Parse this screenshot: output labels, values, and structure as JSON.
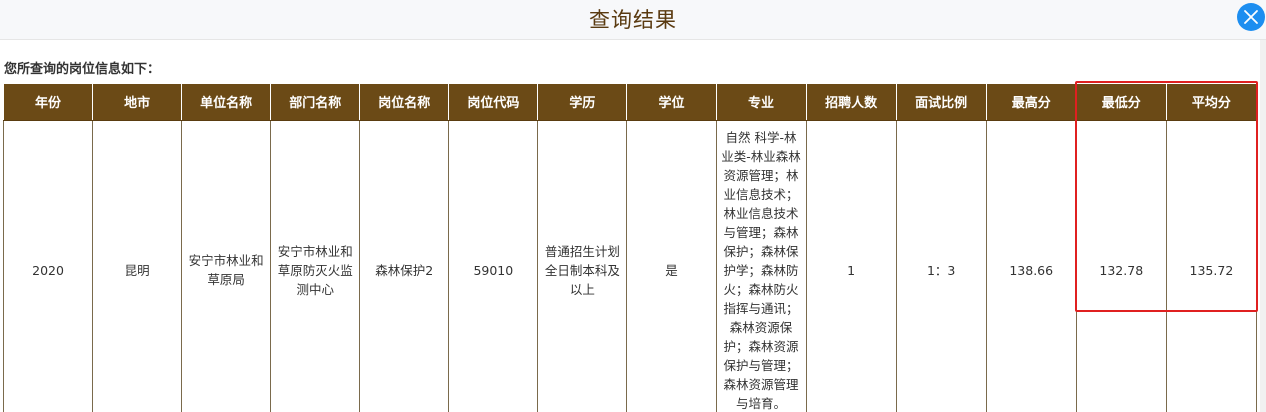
{
  "dialog": {
    "title": "查询结果",
    "close_icon": "close-icon",
    "accent_color": "#1d8ef0"
  },
  "subtitle": "您所查询的岗位信息如下：",
  "table": {
    "header_color": "#6b4a16",
    "headers": [
      "年份",
      "地市",
      "单位名称",
      "部门名称",
      "岗位名称",
      "岗位代码",
      "学历",
      "学位",
      "专业",
      "招聘人数",
      "面试比例",
      "最高分",
      "最低分",
      "平均分"
    ],
    "row": {
      "year": "2020",
      "city": "昆明",
      "unit": "安宁市林业和草原局",
      "department": "安宁市林业和草原防灭火监测中心",
      "position": "森林保护2",
      "code": "59010",
      "education": "普通招生计划全日制本科及以上",
      "degree": "是",
      "major": "自然 科学-林业类-林业森林资源管理；林业信息技术；林业信息技术与管理；森林保护；森林保护学；森林防火；森林防火指挥与通讯；森林资源保护；森林资源保护与管理；森林资源管理与培育。",
      "recruits": "1",
      "ratio": "1：3",
      "max_score": "138.66",
      "min_score": "132.78",
      "avg_score": "135.72"
    }
  },
  "highlight_color": "#e02020"
}
